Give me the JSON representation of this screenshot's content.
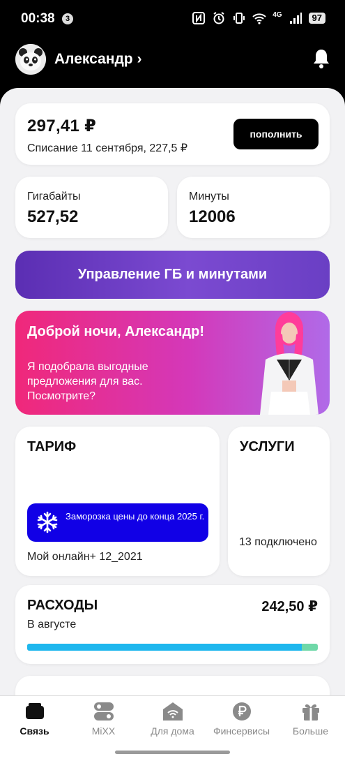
{
  "status_bar": {
    "time": "00:38",
    "notif_count": "3",
    "network": "4G",
    "battery": "97"
  },
  "header": {
    "user_name": "Александр",
    "chevron": "›"
  },
  "balance": {
    "amount": "297,41 ₽",
    "charge_note": "Списание 11 сентября, 227,5 ₽",
    "topup_label": "пополнить"
  },
  "gigabytes": {
    "label": "Гигабайты",
    "value": "527,52"
  },
  "minutes": {
    "label": "Минуты",
    "value": "12006"
  },
  "manage_button": {
    "label": "Управление ГБ и минутами"
  },
  "promo": {
    "headline": "Доброй ночи, Александр!",
    "body": "Я подобрала выгодные предложения для вас. Посмотрите?"
  },
  "tariff": {
    "title": "ТАРИФ",
    "freeze_text": "Заморозка цены до конца 2025 г.",
    "plan_name": "Мой онлайн+ 12_2021"
  },
  "services": {
    "title": "УСЛУГИ",
    "count_text": "13 подключено"
  },
  "spending": {
    "title": "РАСХОДЫ",
    "amount": "242,50 ₽",
    "period": "В августе",
    "bar_fraction": 0.945,
    "colors": {
      "main": "#1fb7ee",
      "rest": "#6fd8a8"
    }
  },
  "bottom_nav": [
    {
      "label": "Связь",
      "icon": "wallet-icon",
      "active": true
    },
    {
      "label": "MiXX",
      "icon": "toggles-icon",
      "active": false
    },
    {
      "label": "Для дома",
      "icon": "home-wifi-icon",
      "active": false
    },
    {
      "label": "Финсервисы",
      "icon": "ruble-coin-icon",
      "active": false
    },
    {
      "label": "Больше",
      "icon": "gift-icon",
      "active": false
    }
  ],
  "colors": {
    "accent_purple": "#5b2eb3",
    "freeze_blue": "#1100e6",
    "promo_pink": "#f0287a"
  }
}
